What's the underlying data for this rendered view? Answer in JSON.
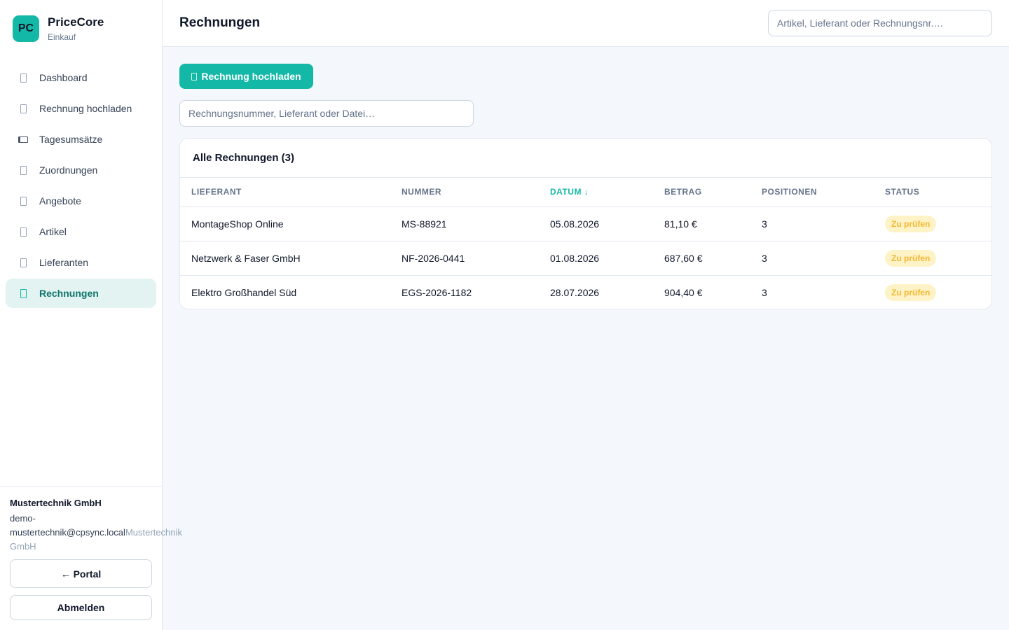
{
  "brand": {
    "logo": "PC",
    "name": "PriceCore",
    "subtitle": "Einkauf"
  },
  "nav": [
    {
      "label": "Dashboard",
      "icon": "dashboard-icon"
    },
    {
      "label": "Rechnung hochladen",
      "icon": "upload-icon"
    },
    {
      "label": "Tagesumsätze",
      "icon": "card-icon"
    },
    {
      "label": "Zuordnungen",
      "icon": "link-icon"
    },
    {
      "label": "Angebote",
      "icon": "offer-icon"
    },
    {
      "label": "Artikel",
      "icon": "box-icon"
    },
    {
      "label": "Lieferanten",
      "icon": "truck-icon"
    },
    {
      "label": "Rechnungen",
      "icon": "invoice-icon",
      "active": true
    }
  ],
  "footer": {
    "company": "Mustertechnik GmbH",
    "email": "demo-mustertechnik@cpsync.local",
    "company_secondary": "Mustertechnik GmbH",
    "portal_label": "← Portal",
    "logout_label": "Abmelden"
  },
  "header": {
    "title": "Rechnungen",
    "search_placeholder": "Artikel, Lieferant oder Rechnungsnr.…"
  },
  "actions": {
    "upload_label": "Rechnung hochladen"
  },
  "filter": {
    "placeholder": "Rechnungsnummer, Lieferant oder Datei…"
  },
  "table": {
    "title": "Alle Rechnungen (3)",
    "columns": [
      "LIEFERANT",
      "NUMMER",
      "DATUM ↓",
      "BETRAG",
      "POSITIONEN",
      "STATUS"
    ],
    "rows": [
      {
        "supplier": "MontageShop Online",
        "number": "MS-88921",
        "date": "05.08.2026",
        "amount": "81,10 €",
        "positions": "3",
        "status": "Zu prüfen"
      },
      {
        "supplier": "Netzwerk & Faser GmbH",
        "number": "NF-2026-0441",
        "date": "01.08.2026",
        "amount": "687,60 €",
        "positions": "3",
        "status": "Zu prüfen"
      },
      {
        "supplier": "Elektro Großhandel Süd",
        "number": "EGS-2026-1182",
        "date": "28.07.2026",
        "amount": "904,40 €",
        "positions": "3",
        "status": "Zu prüfen"
      }
    ]
  },
  "colors": {
    "accent": "#14b8a6",
    "status_warning_bg": "#fef3c7",
    "status_warning_text": "#f5b730"
  }
}
